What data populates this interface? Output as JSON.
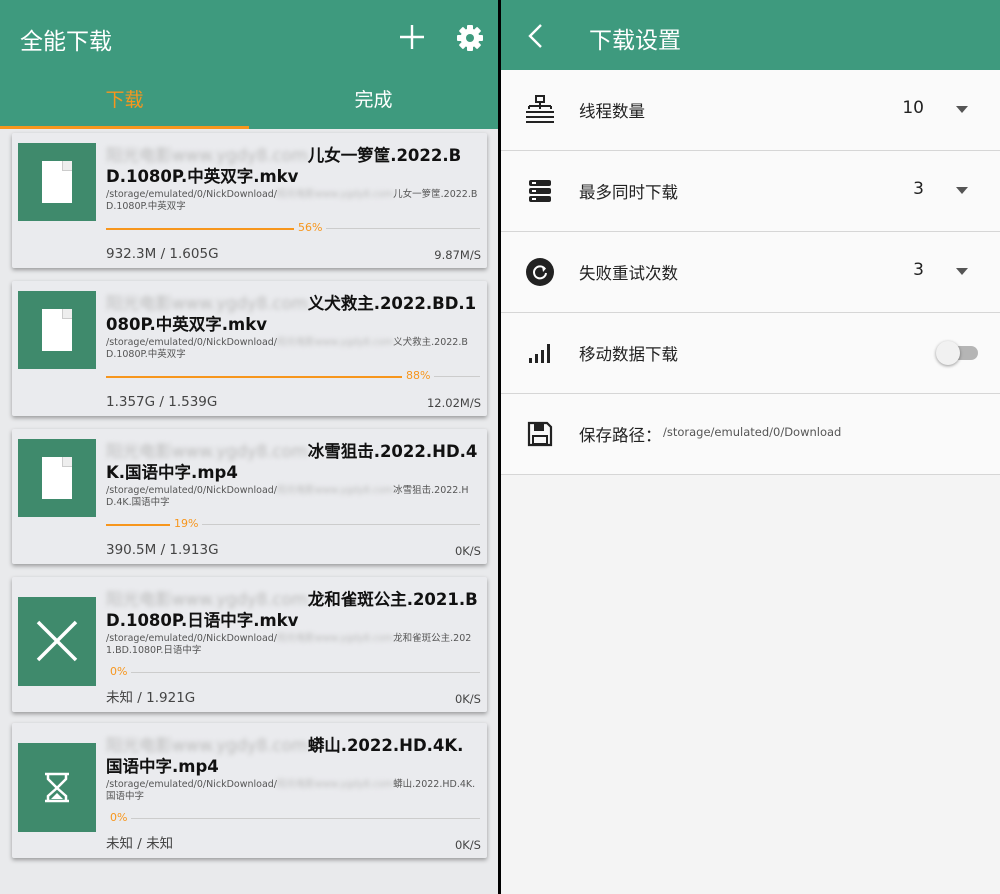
{
  "app": {
    "title": "全能下载"
  },
  "tabs": [
    {
      "label": "下载",
      "active": true
    },
    {
      "label": "完成",
      "active": false
    }
  ],
  "downloads": [
    {
      "blurred": "阳光电影www.ygdy8.com",
      "title": "儿女一箩筐.2022.BD.1080P.中英双字.mkv",
      "path_prefix": "/storage/emulated/0/NickDownload/",
      "path_blur": "阳光电影www.ygdy8.com",
      "path_suffix": "儿女一箩筐.2022.BD.1080P.中英双字",
      "progress": 56,
      "progress_label": "56%",
      "size": "932.3M / 1.605G",
      "speed": "9.87M/S",
      "icon": "document-icon"
    },
    {
      "blurred": "阳光电影www.ygdy8.com",
      "title": "义犬救主.2022.BD.1080P.中英双字.mkv",
      "path_prefix": "/storage/emulated/0/NickDownload/",
      "path_blur": "阳光电影www.ygdy8.com",
      "path_suffix": "义犬救主.2022.BD.1080P.中英双字",
      "progress": 88,
      "progress_label": "88%",
      "size": "1.357G / 1.539G",
      "speed": "12.02M/S",
      "icon": "document-icon"
    },
    {
      "blurred": "阳光电影www.ygdy8.com",
      "title": "冰雪狙击.2022.HD.4K.国语中字.mp4",
      "path_prefix": "/storage/emulated/0/NickDownload/",
      "path_blur": "阳光电影www.ygdy8.com",
      "path_suffix": "冰雪狙击.2022.HD.4K.国语中字",
      "progress": 19,
      "progress_label": "19%",
      "size": "390.5M / 1.913G",
      "speed": "0K/S",
      "icon": "document-icon"
    },
    {
      "blurred": "阳光电影www.ygdy8.com",
      "title": "龙和雀斑公主.2021.BD.1080P.日语中字.mkv",
      "path_prefix": "/storage/emulated/0/NickDownload/",
      "path_blur": "阳光电影www.ygdy8.com",
      "path_suffix": "龙和雀斑公主.2021.BD.1080P.日语中字",
      "progress": 0,
      "progress_label": "0%",
      "size": "未知 / 1.921G",
      "speed": "0K/S",
      "icon": "close-icon"
    },
    {
      "blurred": "阳光电影www.ygdy8.com",
      "title": "蟒山.2022.HD.4K.国语中字.mp4",
      "path_prefix": "/storage/emulated/0/NickDownload/",
      "path_blur": "阳光电影www.ygdy8.com",
      "path_suffix": "蟒山.2022.HD.4K.国语中字",
      "progress": 0,
      "progress_label": "0%",
      "size": "未知 / 未知",
      "speed": "0K/S",
      "icon": "hourglass-icon"
    }
  ],
  "settings": {
    "title": "下载设置",
    "threads": {
      "label": "线程数量",
      "value": "10",
      "icon": "network-tree-icon"
    },
    "concurrent": {
      "label": "最多同时下载",
      "value": "3",
      "icon": "server-stack-icon"
    },
    "retries": {
      "label": "失败重试次数",
      "value": "3",
      "icon": "retry-icon"
    },
    "mobile": {
      "label": "移动数据下载",
      "enabled": false,
      "icon": "signal-bars-icon"
    },
    "save_path": {
      "label": "保存路径：",
      "value": "/storage/emulated/0/Download",
      "icon": "save-icon"
    }
  },
  "colors": {
    "primary": "#3e9a7e",
    "accent": "#f7961d",
    "thumb": "#3f8a6c"
  }
}
